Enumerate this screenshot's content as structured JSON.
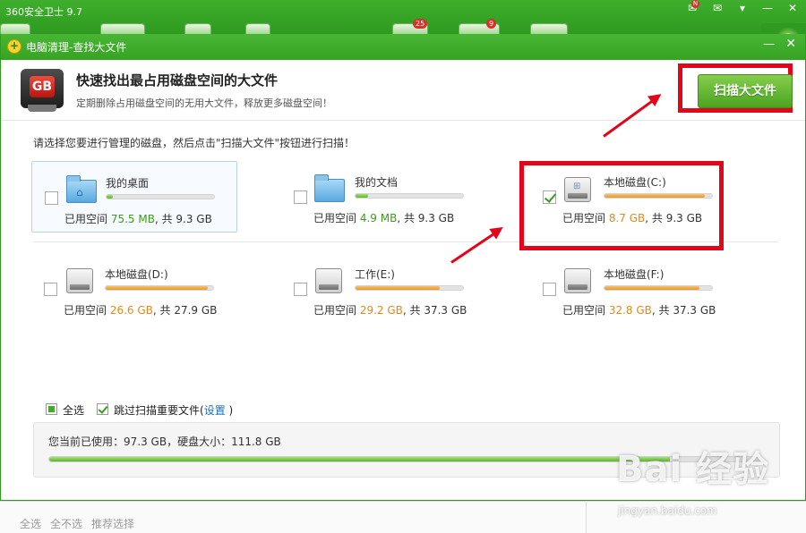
{
  "app": {
    "title": "360安全卫士 9.7",
    "badge_a": "25",
    "badge_b": "9",
    "notify_count": "N"
  },
  "dialog": {
    "title": "电脑清理-查找大文件",
    "header_title": "快速找出最占用磁盘空间的大文件",
    "header_subtitle": "定期删除占用磁盘空间的无用大文件，释放更多磁盘空间！",
    "scan_button": "扫描大文件",
    "instruction": "请选择您要进行管理的磁盘，然后点击\"扫描大文件\"按钮进行扫描！",
    "icon_text": "GB"
  },
  "drives": [
    {
      "name": "我的桌面",
      "used_prefix": "已用空间 ",
      "used": "75.5 MB",
      "total": ", 共 9.3 GB",
      "checked": false,
      "fill": 0.06,
      "color": "green"
    },
    {
      "name": "我的文档",
      "used_prefix": "已用空间 ",
      "used": "4.9 MB",
      "total": ", 共 9.3 GB",
      "checked": false,
      "fill": 0.12,
      "color": "green"
    },
    {
      "name": "本地磁盘(C:)",
      "used_prefix": "已用空间 ",
      "used": "8.7 GB",
      "total": ", 共 9.3 GB",
      "checked": true,
      "fill": 0.93,
      "color": "orange"
    },
    {
      "name": "本地磁盘(D:)",
      "used_prefix": "已用空间 ",
      "used": "26.6 GB",
      "total": ", 共 27.9 GB",
      "checked": false,
      "fill": 0.95,
      "color": "orange"
    },
    {
      "name": "工作(E:)",
      "used_prefix": "已用空间 ",
      "used": "29.2 GB",
      "total": ", 共 37.3 GB",
      "checked": false,
      "fill": 0.78,
      "color": "orange"
    },
    {
      "name": "本地磁盘(F:)",
      "used_prefix": "已用空间 ",
      "used": "32.8 GB",
      "total": ", 共 37.3 GB",
      "checked": false,
      "fill": 0.88,
      "color": "orange"
    }
  ],
  "options": {
    "select_all": "全选",
    "skip_important": "跳过扫描重要文件(",
    "settings_link": "设置",
    "close_paren": " )"
  },
  "usage": {
    "text": "您当前已使用：97.3 GB，硬盘大小：111.8 GB",
    "fill": 0.87
  },
  "background": {
    "links": [
      "全选",
      "全不选",
      "推荐选择"
    ]
  },
  "watermark": {
    "main": "Bai 经验",
    "sub": "jingyan.baidu.com"
  },
  "colors": {
    "accent_green": "#3fae2c",
    "highlight_red": "#e3061b",
    "used_green": "#3c9c1a",
    "used_orange": "#e08a1a"
  }
}
